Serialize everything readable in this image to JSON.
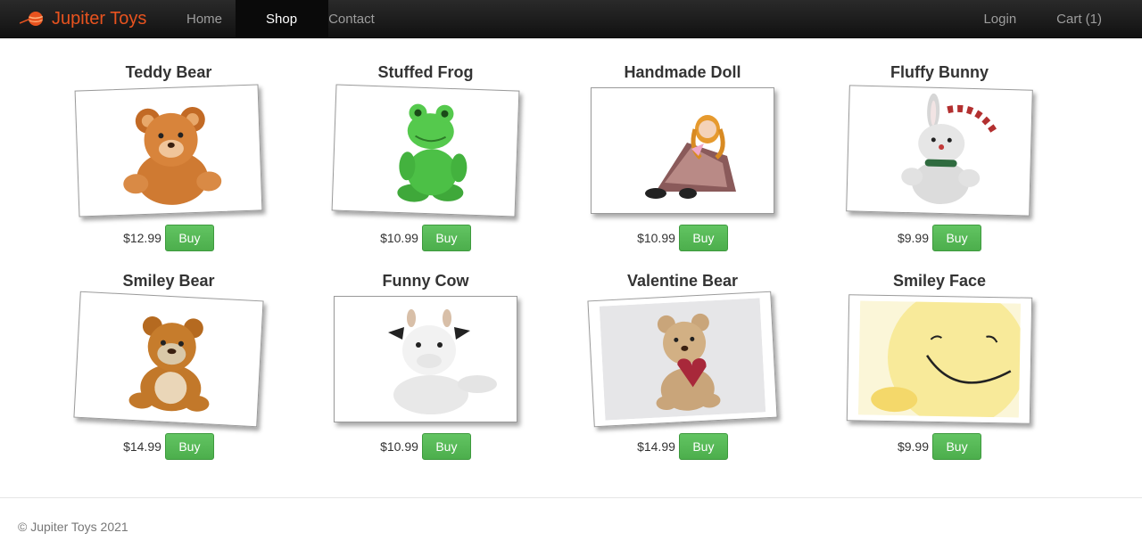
{
  "brand": {
    "name": "Jupiter Toys"
  },
  "nav": {
    "left": [
      {
        "label": "Home",
        "active": false
      },
      {
        "label": "Shop",
        "active": true
      },
      {
        "label": "Contact",
        "active": false
      }
    ],
    "right": [
      {
        "label": "Login"
      },
      {
        "label": "Cart (1)"
      }
    ]
  },
  "products": [
    {
      "title": "Teddy Bear",
      "price": "$12.99",
      "buy_label": "Buy",
      "image": "teddy-bear"
    },
    {
      "title": "Stuffed Frog",
      "price": "$10.99",
      "buy_label": "Buy",
      "image": "stuffed-frog"
    },
    {
      "title": "Handmade Doll",
      "price": "$10.99",
      "buy_label": "Buy",
      "image": "handmade-doll"
    },
    {
      "title": "Fluffy Bunny",
      "price": "$9.99",
      "buy_label": "Buy",
      "image": "fluffy-bunny"
    },
    {
      "title": "Smiley Bear",
      "price": "$14.99",
      "buy_label": "Buy",
      "image": "smiley-bear"
    },
    {
      "title": "Funny Cow",
      "price": "$10.99",
      "buy_label": "Buy",
      "image": "funny-cow"
    },
    {
      "title": "Valentine Bear",
      "price": "$14.99",
      "buy_label": "Buy",
      "image": "valentine-bear"
    },
    {
      "title": "Smiley Face",
      "price": "$9.99",
      "buy_label": "Buy",
      "image": "smiley-face"
    }
  ],
  "footer": {
    "copyright": "© Jupiter Toys 2021"
  },
  "colors": {
    "brand": "#e8531f",
    "buy_button": "#5cb85c",
    "navbar": "#1b1b1b"
  }
}
